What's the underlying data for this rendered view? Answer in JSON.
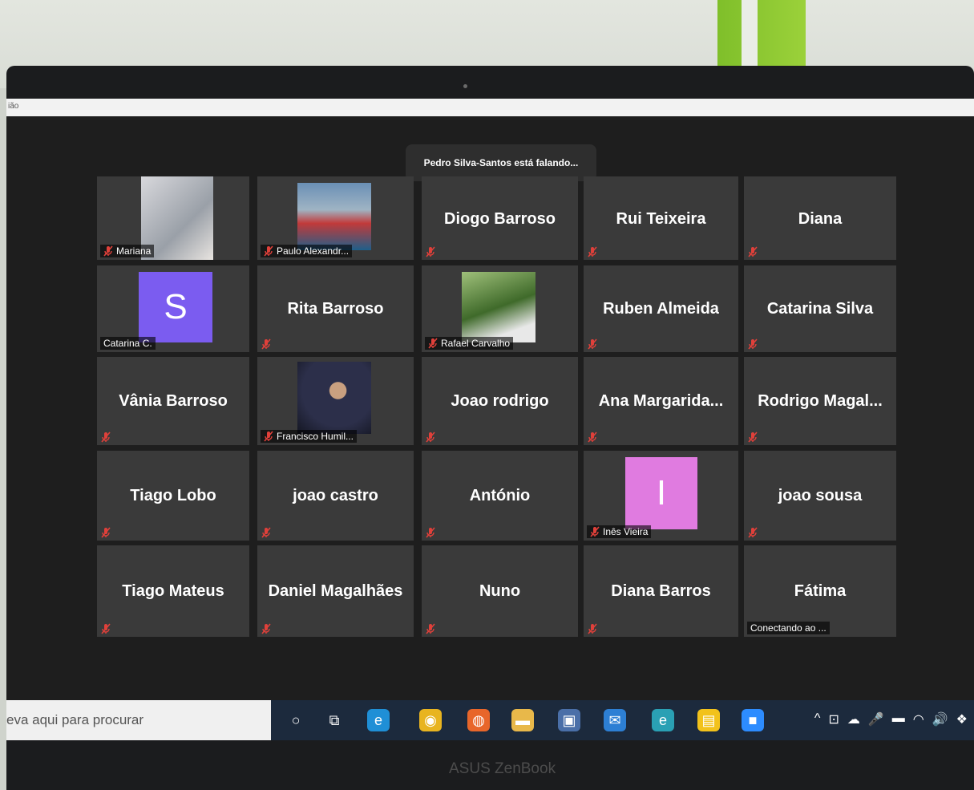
{
  "window": {
    "title_fragment": "ião"
  },
  "meeting": {
    "speaking_banner": "Pedro Silva-Santos está falando..."
  },
  "tiles": [
    {
      "name": "Mariana",
      "kind": "photo",
      "muted": true
    },
    {
      "name": "Paulo Alexandr...",
      "kind": "photo",
      "muted": true
    },
    {
      "name": "Diogo Barroso",
      "kind": "text",
      "muted": true
    },
    {
      "name": "Rui Teixeira",
      "kind": "text",
      "muted": true
    },
    {
      "name": "Diana",
      "kind": "text",
      "muted": true
    },
    {
      "name": "Catarina C.",
      "kind": "avatar",
      "initial": "S",
      "avatar_color": "#7b5cf0",
      "muted": false
    },
    {
      "name": "Rita Barroso",
      "kind": "text",
      "muted": true
    },
    {
      "name": "Rafael Carvalho",
      "kind": "photo",
      "muted": true
    },
    {
      "name": "Ruben Almeida",
      "kind": "text",
      "muted": true
    },
    {
      "name": "Catarina Silva",
      "kind": "text",
      "muted": true
    },
    {
      "name": "Vânia Barroso",
      "kind": "text",
      "muted": true
    },
    {
      "name": "Francisco Humil...",
      "kind": "photo",
      "muted": true
    },
    {
      "name": "Joao rodrigo",
      "kind": "text",
      "muted": true
    },
    {
      "name": "Ana  Margarida...",
      "kind": "text",
      "muted": true
    },
    {
      "name": "Rodrigo  Magal...",
      "kind": "text",
      "muted": true
    },
    {
      "name": "Tiago Lobo",
      "kind": "text",
      "muted": true
    },
    {
      "name": "joao castro",
      "kind": "text",
      "muted": true
    },
    {
      "name": "António",
      "kind": "text",
      "muted": true
    },
    {
      "name": "Inês Vieira",
      "kind": "avatar",
      "initial": "I",
      "avatar_color": "#e07be0",
      "muted": true
    },
    {
      "name": "joao sousa",
      "kind": "text",
      "muted": true
    },
    {
      "name": "Tiago Mateus",
      "kind": "text",
      "muted": true
    },
    {
      "name": "Daniel Magalhães",
      "kind": "text",
      "muted": true
    },
    {
      "name": "Nuno",
      "kind": "text",
      "muted": true
    },
    {
      "name": "Diana Barros",
      "kind": "text",
      "muted": true
    },
    {
      "name": "Fátima",
      "kind": "text",
      "muted": false,
      "status": "Conectando ao ..."
    }
  ],
  "taskbar": {
    "search_placeholder": "eva aqui para procurar",
    "icons": [
      "cortana-icon",
      "task-view-icon",
      "edge-icon",
      "chrome-icon",
      "firefox-icon",
      "file-explorer-icon",
      "store-icon",
      "mail-icon",
      "edge-profile-icon",
      "sticky-notes-icon",
      "zoom-icon"
    ],
    "tray_icons": [
      "chevron-up-icon",
      "meet-now-icon",
      "onedrive-icon",
      "microphone-icon",
      "battery-icon",
      "wifi-icon",
      "volume-icon",
      "dropbox-icon"
    ]
  },
  "laptop": {
    "brand": "ASUS ZenBook"
  },
  "colors": {
    "tile_bg": "#3a3a3a",
    "app_bg": "#1e1e1e",
    "mute_red": "#e0403a",
    "taskbar_bg": "#1c2a3d"
  }
}
